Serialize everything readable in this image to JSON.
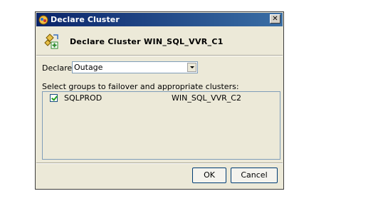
{
  "window": {
    "title": "Declare Cluster",
    "close_glyph": "✕",
    "title_icon": "cluster-icon"
  },
  "header": {
    "title": "Declare Cluster WIN_SQL_VVR_C1",
    "icon": "cluster-declare-icon"
  },
  "declare": {
    "label": "Declare",
    "selected": "Outage"
  },
  "groups": {
    "label": "Select groups to failover and appropriate clusters:",
    "rows": [
      {
        "checked": true,
        "name": "SQLPROD",
        "cluster": "WIN_SQL_VVR_C2"
      }
    ]
  },
  "buttons": {
    "ok": "OK",
    "cancel": "Cancel"
  },
  "colors": {
    "title_bar_start": "#0a246a",
    "title_bar_end": "#3a6ea5",
    "dialog_bg": "#ece9d8",
    "check": "#21a121"
  }
}
